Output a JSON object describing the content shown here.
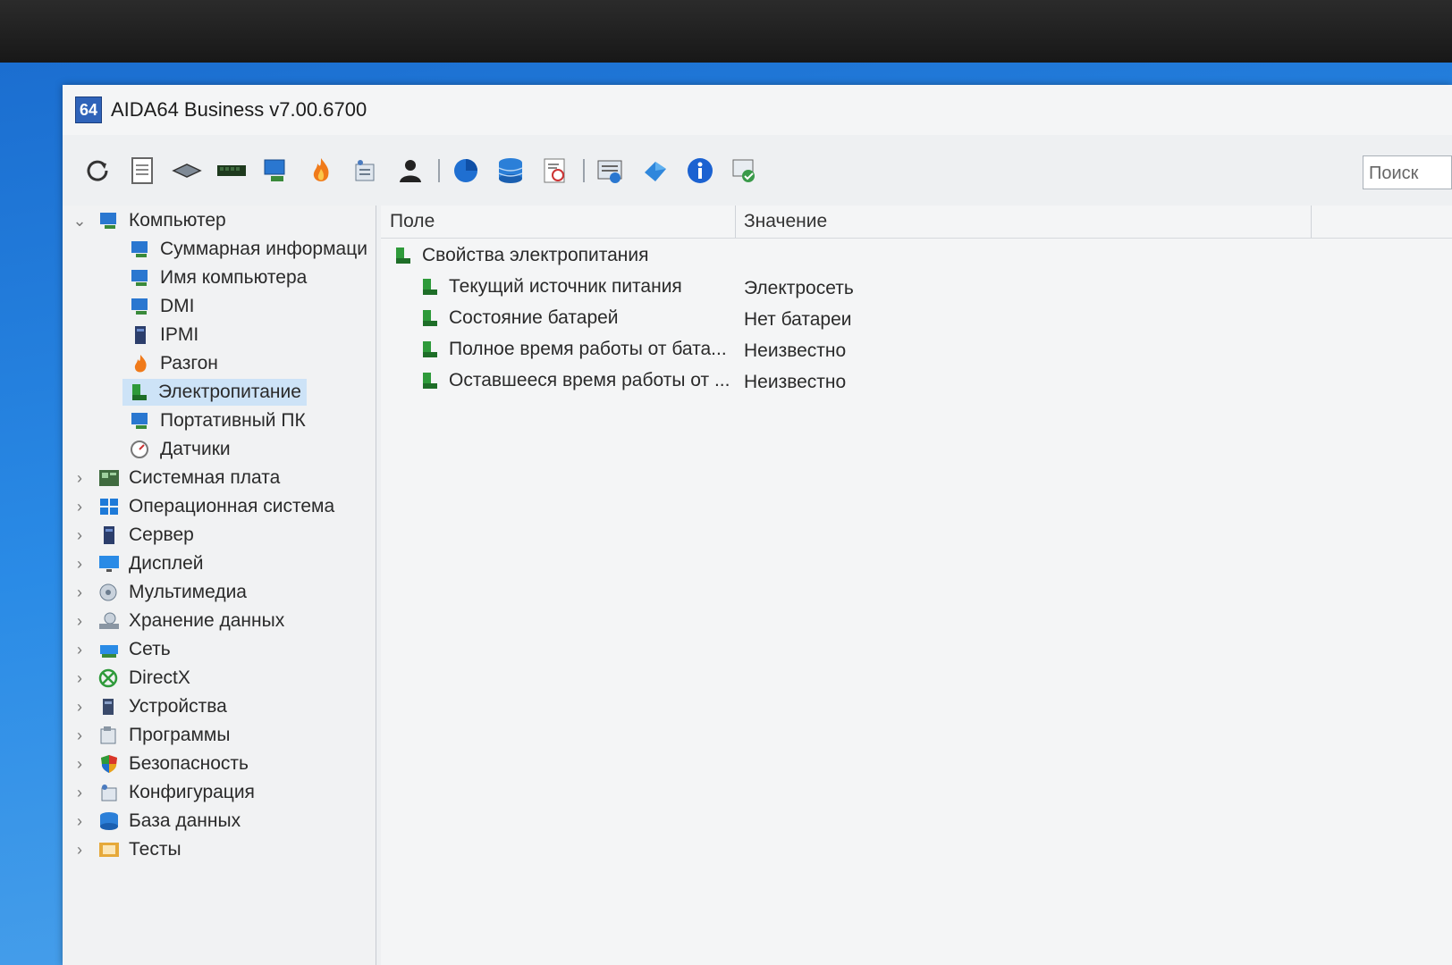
{
  "window": {
    "title": "AIDA64 Business v7.00.6700",
    "icon_text": "64"
  },
  "toolbar": {
    "buttons": [
      "refresh-icon",
      "report-icon",
      "motherboard-icon",
      "memory-icon",
      "computer-icon",
      "flame-icon",
      "config-icon",
      "user-icon",
      "directx-sphere-icon",
      "database-icon",
      "benchmark-icon",
      "network-icon",
      "update-icon",
      "info-icon",
      "audit-icon"
    ],
    "search_placeholder": "Поиск"
  },
  "tree": {
    "root": {
      "label": "Компьютер",
      "icon": "computer-icon"
    },
    "children": [
      {
        "label": "Суммарная информаци",
        "icon": "computer-icon"
      },
      {
        "label": "Имя компьютера",
        "icon": "computer-icon"
      },
      {
        "label": "DMI",
        "icon": "computer-icon"
      },
      {
        "label": "IPMI",
        "icon": "server-icon"
      },
      {
        "label": "Разгон",
        "icon": "flame-icon"
      },
      {
        "label": "Электропитание",
        "icon": "power-icon",
        "selected": true
      },
      {
        "label": "Портативный ПК",
        "icon": "computer-icon"
      },
      {
        "label": "Датчики",
        "icon": "sensor-icon"
      }
    ],
    "sections": [
      {
        "label": "Системная плата",
        "icon": "motherboard-icon"
      },
      {
        "label": "Операционная система",
        "icon": "windows-icon"
      },
      {
        "label": "Сервер",
        "icon": "server-icon"
      },
      {
        "label": "Дисплей",
        "icon": "display-icon"
      },
      {
        "label": "Мультимедиа",
        "icon": "multimedia-icon"
      },
      {
        "label": "Хранение данных",
        "icon": "storage-icon"
      },
      {
        "label": "Сеть",
        "icon": "network-icon"
      },
      {
        "label": "DirectX",
        "icon": "xbox-icon"
      },
      {
        "label": "Устройства",
        "icon": "devices-icon"
      },
      {
        "label": "Программы",
        "icon": "programs-icon"
      },
      {
        "label": "Безопасность",
        "icon": "shield-icon"
      },
      {
        "label": "Конфигурация",
        "icon": "config-icon"
      },
      {
        "label": "База данных",
        "icon": "database-icon"
      },
      {
        "label": "Тесты",
        "icon": "tests-icon"
      }
    ]
  },
  "list": {
    "columns": [
      "Поле",
      "Значение"
    ],
    "group": "Свойства электропитания",
    "rows": [
      {
        "field": "Текущий источник питания",
        "value": "Электросеть"
      },
      {
        "field": "Состояние батарей",
        "value": "Нет батареи"
      },
      {
        "field": "Полное время работы от бата...",
        "value": "Неизвестно"
      },
      {
        "field": "Оставшееся время работы от ...",
        "value": "Неизвестно"
      }
    ]
  },
  "colors": {
    "accent": "#2f63b9",
    "selection": "#cde3f7",
    "power_green": "#2e9a3a"
  }
}
